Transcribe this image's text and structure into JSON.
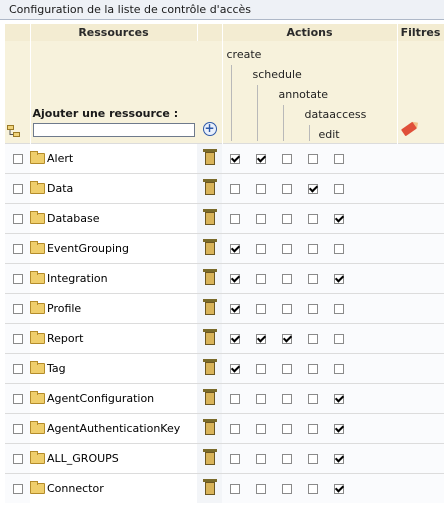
{
  "panel": {
    "title": "Configuration de la liste de contrôle d'accès"
  },
  "headers": {
    "resources": "Ressources",
    "actions": "Actions",
    "filters": "Filtres"
  },
  "add_resource": {
    "label": "Ajouter une ressource :",
    "value": ""
  },
  "action_names": [
    "create",
    "schedule",
    "annotate",
    "dataaccess",
    "edit"
  ],
  "rows": [
    {
      "name": "Alert",
      "checked": false,
      "actions": [
        true,
        true,
        false,
        false,
        false
      ]
    },
    {
      "name": "Data",
      "checked": false,
      "actions": [
        false,
        false,
        false,
        true,
        false
      ]
    },
    {
      "name": "Database",
      "checked": false,
      "actions": [
        false,
        false,
        false,
        false,
        true
      ]
    },
    {
      "name": "EventGrouping",
      "checked": false,
      "actions": [
        true,
        false,
        false,
        false,
        false
      ]
    },
    {
      "name": "Integration",
      "checked": false,
      "actions": [
        true,
        false,
        false,
        false,
        true
      ]
    },
    {
      "name": "Profile",
      "checked": false,
      "actions": [
        true,
        false,
        false,
        false,
        false
      ]
    },
    {
      "name": "Report",
      "checked": false,
      "actions": [
        true,
        true,
        true,
        false,
        false
      ]
    },
    {
      "name": "Tag",
      "checked": false,
      "actions": [
        true,
        false,
        false,
        false,
        false
      ]
    },
    {
      "name": "AgentConfiguration",
      "checked": false,
      "actions": [
        false,
        false,
        false,
        false,
        true
      ]
    },
    {
      "name": "AgentAuthenticationKey",
      "checked": false,
      "actions": [
        false,
        false,
        false,
        false,
        true
      ]
    },
    {
      "name": "ALL_GROUPS",
      "checked": false,
      "actions": [
        false,
        false,
        false,
        false,
        true
      ]
    },
    {
      "name": "Connector",
      "checked": false,
      "actions": [
        false,
        false,
        false,
        false,
        true
      ]
    }
  ],
  "icons": {
    "hierarchy": "hierarchy-icon",
    "add": "add-circle-icon",
    "filter_edit": "pencil-icon",
    "folder": "folder-icon",
    "delete": "trash-icon"
  },
  "colors": {
    "header_bg": "#f3ecd2",
    "title_bg": "#eef1f6",
    "add_icon": "#2f5aa8"
  }
}
